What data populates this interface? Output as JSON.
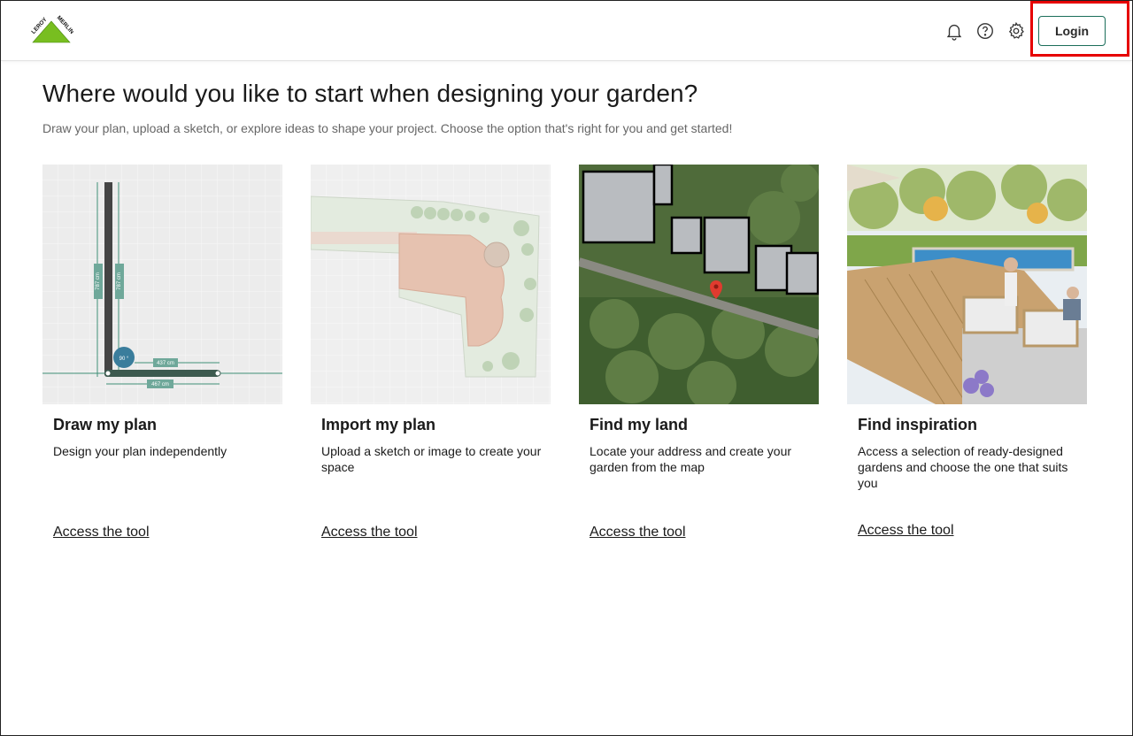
{
  "header": {
    "logo_alt": "LEROY MERLIN",
    "login_label": "Login",
    "accent_color": "#1b6e5a",
    "highlight_color": "#e60000",
    "icons": [
      "bell-icon",
      "help-icon",
      "gear-icon"
    ]
  },
  "main": {
    "title": "Where would you like to start when designing your garden?",
    "subtitle": "Draw your plan, upload a sketch, or explore ideas to shape your project. Choose the option that's right for you and get started!",
    "cards": [
      {
        "title": "Draw my plan",
        "description": "Design your plan independently",
        "link": "Access the tool",
        "image_labels": [
          "787 cm",
          "787 cm",
          "437 cm",
          "467 cm",
          "90 °"
        ]
      },
      {
        "title": "Import my plan",
        "description": "Upload a sketch or image to create your space",
        "link": "Access the tool"
      },
      {
        "title": "Find my land",
        "description": "Locate your address and create your garden from the map",
        "link": "Access the tool"
      },
      {
        "title": "Find inspiration",
        "description": "Access a selection of ready-designed gardens and choose the one that suits you",
        "link": "Access the tool"
      }
    ]
  }
}
